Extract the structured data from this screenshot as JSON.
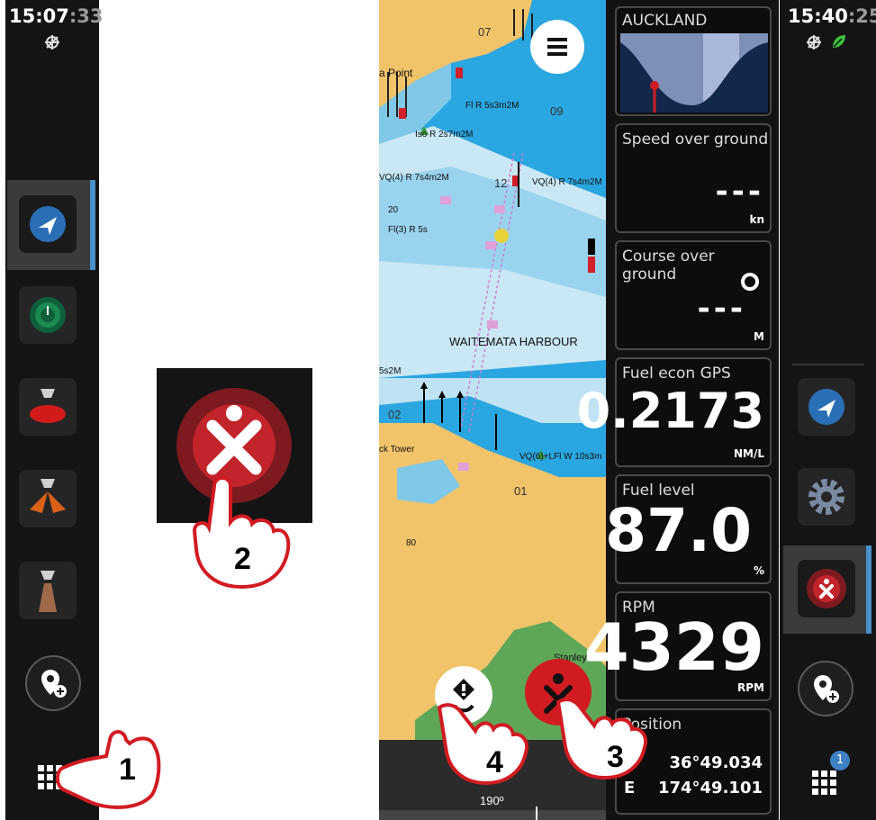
{
  "left_rail": {
    "time_main": "15:07",
    "time_sec": ":33",
    "apps": [
      "navigation-app",
      "radar-app",
      "sonar-app",
      "sidescan-app",
      "downscan-app"
    ]
  },
  "zoom_mob_button": {
    "icon": "mob-x-icon"
  },
  "chart": {
    "labels": [
      "a Point",
      "Fl R 5s3m2M",
      "Iso R 2s7m2M",
      "VQ(4) R 7s4m2M",
      "VQ(4) R 7s4m2M",
      "Fl(3) R 5s",
      "WAITEMATA HARBOUR",
      "5s2M",
      "ck Tower",
      "VQ(6)+LFl W 10s3m",
      "Stanley P",
      "20",
      "80",
      "190º"
    ],
    "depths": [
      "07",
      "09",
      "12",
      "02",
      "01"
    ]
  },
  "panels": {
    "tide": {
      "label": "AUCKLAND"
    },
    "sog": {
      "label": "Speed over ground",
      "value": "---",
      "unit": "kn"
    },
    "cog": {
      "label": "Course over ground",
      "value": "---",
      "unit": "M"
    },
    "fuel_econ": {
      "label": "Fuel econ GPS",
      "value": "0.2173",
      "unit": "NM/L"
    },
    "fuel_level": {
      "label": "Fuel level",
      "value": "87.0",
      "unit": "%"
    },
    "rpm": {
      "label": "RPM",
      "value": "4329",
      "unit": "RPM"
    },
    "position": {
      "label": "Position",
      "lat_prefix": "N",
      "lat": "36°49.034",
      "lon_prefix": "E",
      "lon": "174°49.101"
    }
  },
  "right_rail": {
    "time_main": "15:40",
    "time_sec": ":25",
    "notification_count": "1"
  },
  "callouts": [
    "1",
    "2",
    "3",
    "4"
  ]
}
